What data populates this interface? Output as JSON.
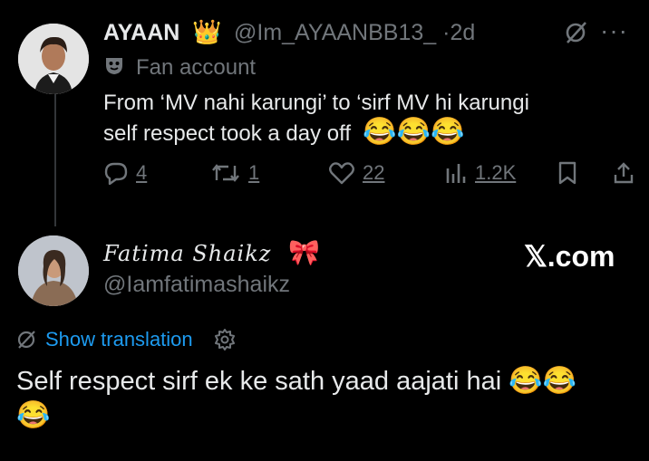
{
  "tweet": {
    "author_name": "AYAAN",
    "author_emoji": "👑",
    "handle": "@Im_AYAANBB13_",
    "sep": "·",
    "time": "2d",
    "label": "Fan account",
    "text_line1": "From ‘MV nahi karungi’ to ‘sirf MV hi karungi",
    "text_line2": "self respect took a day off",
    "emojis": "😂😂😂",
    "stats": {
      "replies": "4",
      "reposts": "1",
      "likes": "22",
      "views": "1.2K"
    }
  },
  "reply": {
    "author_name": "Fatima Shaikz",
    "author_emoji": "🎀",
    "handle": "@Iamfatimashaikz",
    "watermark": "𝕏.com",
    "show_translation": "Show translation",
    "text": "Self respect sirf ek ke sath yaad aajati hai",
    "emojis_inline": "😂😂",
    "emojis_next": "😂"
  },
  "icons": [
    "grok-icon",
    "more-icon",
    "mask-icon",
    "reply-icon",
    "repost-icon",
    "like-icon",
    "views-icon",
    "bookmark-icon",
    "share-icon",
    "translate-icon",
    "settings-icon"
  ]
}
